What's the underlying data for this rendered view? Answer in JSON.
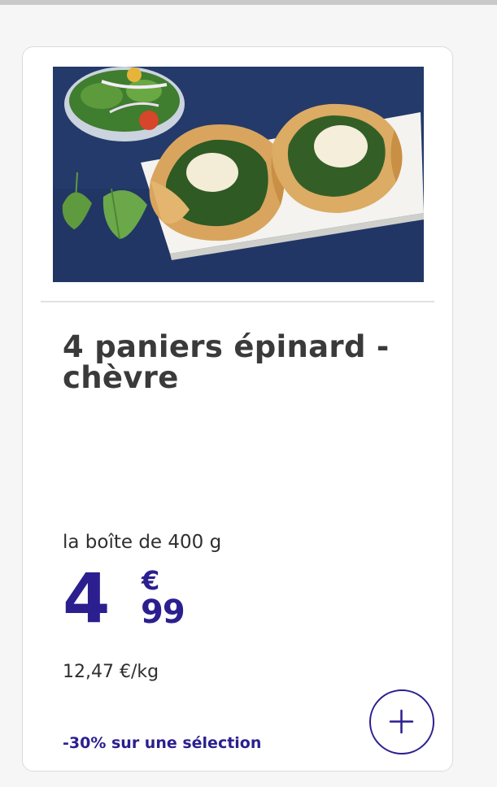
{
  "product": {
    "name": "4 paniers épinard - chèvre",
    "image_alt": "Paniers feuilletés aux épinards et fromage de chèvre sur un plat blanc",
    "package": "la boîte de 400 g",
    "price": {
      "integer": "4",
      "currency": "€",
      "decimal": "99"
    },
    "unit_price": "12,47 €/kg",
    "promo": "-30% sur une sélection"
  },
  "actions": {
    "add_icon": "plus-icon"
  },
  "colors": {
    "accent": "#2b1f8f",
    "text": "#3a3a3a",
    "card_background": "#ffffff",
    "page_background": "#f6f6f6"
  }
}
